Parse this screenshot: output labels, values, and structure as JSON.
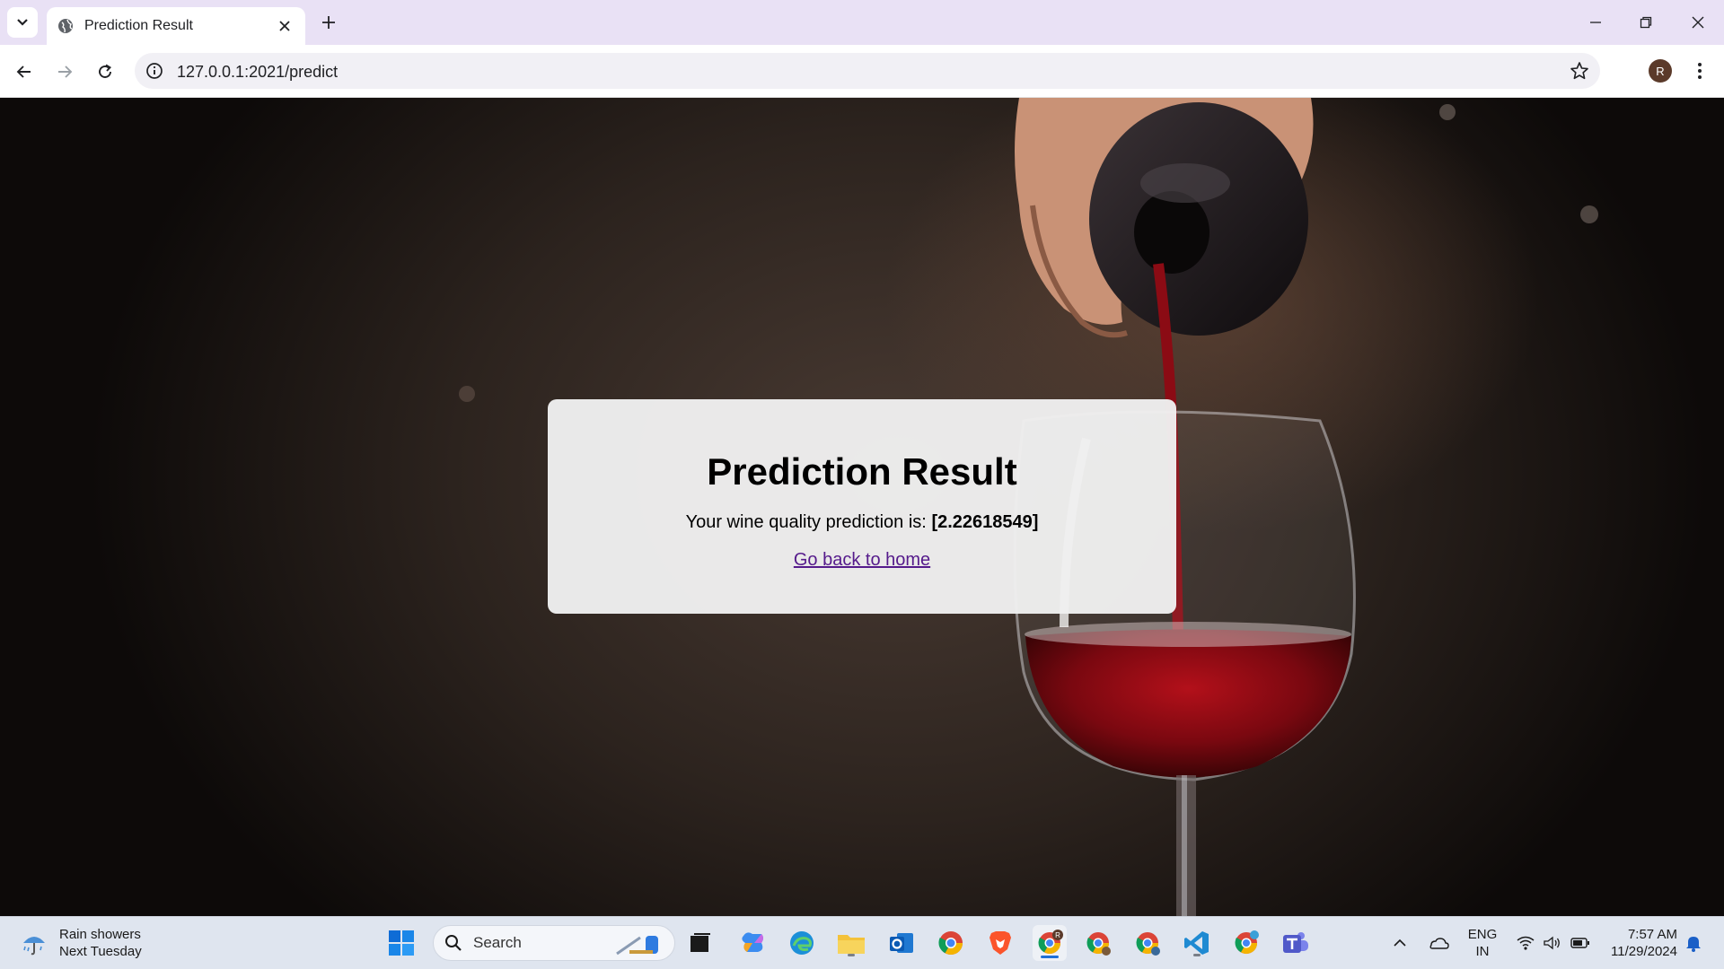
{
  "browser": {
    "tab": {
      "title": "Prediction Result"
    },
    "address": {
      "url": "127.0.0.1:2021/predict"
    },
    "profile_initial": "R"
  },
  "page": {
    "title": "Prediction Result",
    "message_prefix": "Your wine quality prediction is:",
    "prediction_value": "[2.22618549]",
    "home_link": "Go back to home",
    "link_color": "#551a8b"
  },
  "taskbar": {
    "weather": {
      "condition": "Rain showers",
      "when": "Next Tuesday"
    },
    "search_placeholder": "Search",
    "apps": [
      "start-icon",
      "search-icon",
      "task-view-icon",
      "copilot-icon",
      "edge-icon",
      "file-explorer-icon",
      "outlook-icon",
      "chrome-icon",
      "brave-icon",
      "chrome-profile-r-icon",
      "chrome-profile-2-icon",
      "chrome-profile-3-icon",
      "vscode-icon",
      "chrome-profile-k-icon",
      "teams-icon"
    ],
    "tray": {
      "language_top": "ENG",
      "language_bottom": "IN",
      "time": "7:57 AM",
      "date": "11/29/2024"
    }
  }
}
